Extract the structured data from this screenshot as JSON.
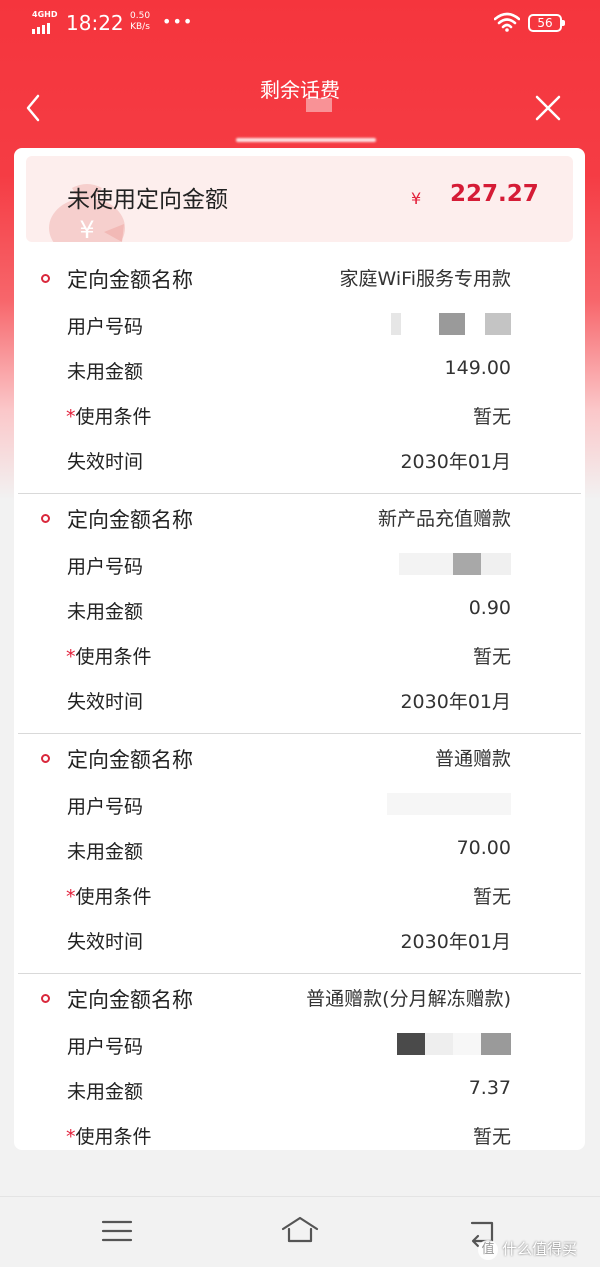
{
  "status_bar": {
    "network": "4GHD",
    "time": "18:22",
    "speed_value": "0.50",
    "speed_unit": "KB/s",
    "more": "•••",
    "battery": "56"
  },
  "nav": {
    "title": "剩余话费"
  },
  "summary": {
    "label": "未使用定向金额",
    "currency": "¥",
    "amount": "227.27"
  },
  "sections": [
    {
      "name_label": "定向金额名称",
      "name_value": "家庭WiFi服务专用款",
      "user_label": "用户号码",
      "unused_label": "未用金额",
      "unused_value": "149.00",
      "cond_star": "*",
      "cond_label": "使用条件",
      "cond_value": "暂无",
      "expire_label": "失效时间",
      "expire_value": "2030年01月"
    },
    {
      "name_label": "定向金额名称",
      "name_value": "新产品充值赠款",
      "user_label": "用户号码",
      "unused_label": "未用金额",
      "unused_value": "0.90",
      "cond_star": "*",
      "cond_label": "使用条件",
      "cond_value": "暂无",
      "expire_label": "失效时间",
      "expire_value": "2030年01月"
    },
    {
      "name_label": "定向金额名称",
      "name_value": "普通赠款",
      "user_label": "用户号码",
      "unused_label": "未用金额",
      "unused_value": "70.00",
      "cond_star": "*",
      "cond_label": "使用条件",
      "cond_value": "暂无",
      "expire_label": "失效时间",
      "expire_value": "2030年01月"
    },
    {
      "name_label": "定向金额名称",
      "name_value": "普通赠款(分月解冻赠款)",
      "user_label": "用户号码",
      "unused_label": "未用金额",
      "unused_value": "7.37",
      "cond_star": "*",
      "cond_label": "使用条件",
      "cond_value": "暂无"
    }
  ],
  "watermark": {
    "badge": "值",
    "text": "什么值得买"
  },
  "colors": {
    "brand_red": "#f5353d",
    "amount_red": "#d51c36",
    "card_bg": "#ffffff"
  }
}
